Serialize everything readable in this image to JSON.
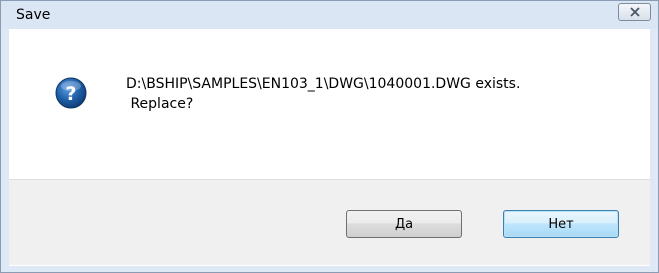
{
  "window": {
    "title": "Save"
  },
  "dialog": {
    "icon": "question-icon",
    "message_line1": "D:\\BSHIP\\SAMPLES\\EN103_1\\DWG\\1040001.DWG exists.",
    "message_line2": " Replace?"
  },
  "buttons": {
    "yes_label": "Да",
    "no_label": "Нет"
  },
  "colors": {
    "accent": "#1f5fa8",
    "focused_button_border": "#3c7fb1"
  }
}
